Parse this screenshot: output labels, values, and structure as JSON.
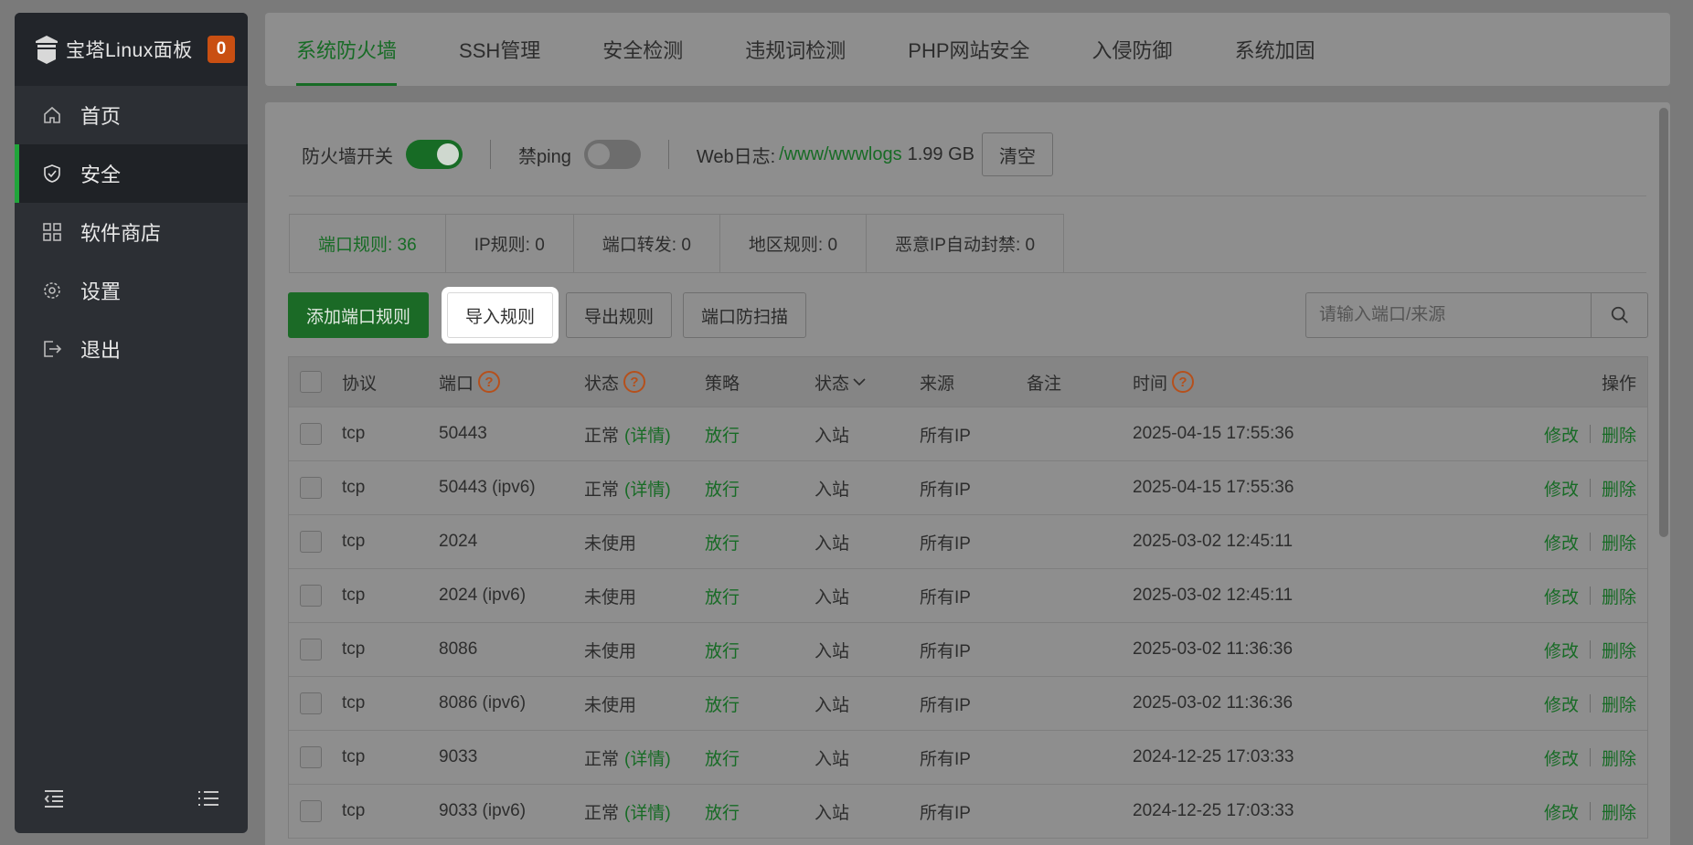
{
  "sidebar": {
    "brand": "宝塔Linux面板",
    "badge": "0",
    "items": [
      {
        "label": "首页",
        "icon": "home-icon"
      },
      {
        "label": "安全",
        "icon": "shield-icon"
      },
      {
        "label": "软件商店",
        "icon": "grid-icon"
      },
      {
        "label": "设置",
        "icon": "gear-icon"
      },
      {
        "label": "退出",
        "icon": "logout-icon"
      }
    ],
    "active_item": "安全"
  },
  "top_tabs": [
    "系统防火墙",
    "SSH管理",
    "安全检测",
    "违规词检测",
    "PHP网站安全",
    "入侵防御",
    "系统加固"
  ],
  "active_tab": "系统防火墙",
  "settings": {
    "firewall_label": "防火墙开关",
    "firewall_on": true,
    "ping_label": "禁ping",
    "ping_on": false,
    "weblog_label": "Web日志:",
    "weblog_path": "/www/wwwlogs",
    "weblog_size": "1.99 GB",
    "clear_label": "清空"
  },
  "sub_tabs": [
    "端口规则: 36",
    "IP规则: 0",
    "端口转发: 0",
    "地区规则: 0",
    "恶意IP自动封禁: 0"
  ],
  "actions": {
    "add": "添加端口规则",
    "import": "导入规则",
    "export": "导出规则",
    "scan": "端口防扫描",
    "search_placeholder": "请输入端口/来源"
  },
  "table": {
    "headers": {
      "protocol": "协议",
      "port": "端口",
      "status": "状态",
      "policy": "策略",
      "direction": "状态",
      "source": "来源",
      "remark": "备注",
      "time": "时间",
      "ops": "操作"
    },
    "edit_label": "修改",
    "delete_label": "删除",
    "rows": [
      {
        "protocol": "tcp",
        "port": "50443",
        "status": "正常",
        "detail": "(详情)",
        "policy": "放行",
        "direction": "入站",
        "source": "所有IP",
        "remark": "",
        "time": "2025-04-15 17:55:36"
      },
      {
        "protocol": "tcp",
        "port": "50443 (ipv6)",
        "status": "正常",
        "detail": "(详情)",
        "policy": "放行",
        "direction": "入站",
        "source": "所有IP",
        "remark": "",
        "time": "2025-04-15 17:55:36"
      },
      {
        "protocol": "tcp",
        "port": "2024",
        "status": "未使用",
        "detail": "",
        "policy": "放行",
        "direction": "入站",
        "source": "所有IP",
        "remark": "",
        "time": "2025-03-02 12:45:11"
      },
      {
        "protocol": "tcp",
        "port": "2024 (ipv6)",
        "status": "未使用",
        "detail": "",
        "policy": "放行",
        "direction": "入站",
        "source": "所有IP",
        "remark": "",
        "time": "2025-03-02 12:45:11"
      },
      {
        "protocol": "tcp",
        "port": "8086",
        "status": "未使用",
        "detail": "",
        "policy": "放行",
        "direction": "入站",
        "source": "所有IP",
        "remark": "",
        "time": "2025-03-02 11:36:36"
      },
      {
        "protocol": "tcp",
        "port": "8086 (ipv6)",
        "status": "未使用",
        "detail": "",
        "policy": "放行",
        "direction": "入站",
        "source": "所有IP",
        "remark": "",
        "time": "2025-03-02 11:36:36"
      },
      {
        "protocol": "tcp",
        "port": "9033",
        "status": "正常",
        "detail": "(详情)",
        "policy": "放行",
        "direction": "入站",
        "source": "所有IP",
        "remark": "",
        "time": "2024-12-25 17:03:33"
      },
      {
        "protocol": "tcp",
        "port": "9033 (ipv6)",
        "status": "正常",
        "detail": "(详情)",
        "policy": "放行",
        "direction": "入站",
        "source": "所有IP",
        "remark": "",
        "time": "2024-12-25 17:03:33"
      }
    ]
  },
  "colors": {
    "accent_green": "#20a53a",
    "badge_orange": "#c94f12",
    "overlay": "#7a7a7a"
  }
}
